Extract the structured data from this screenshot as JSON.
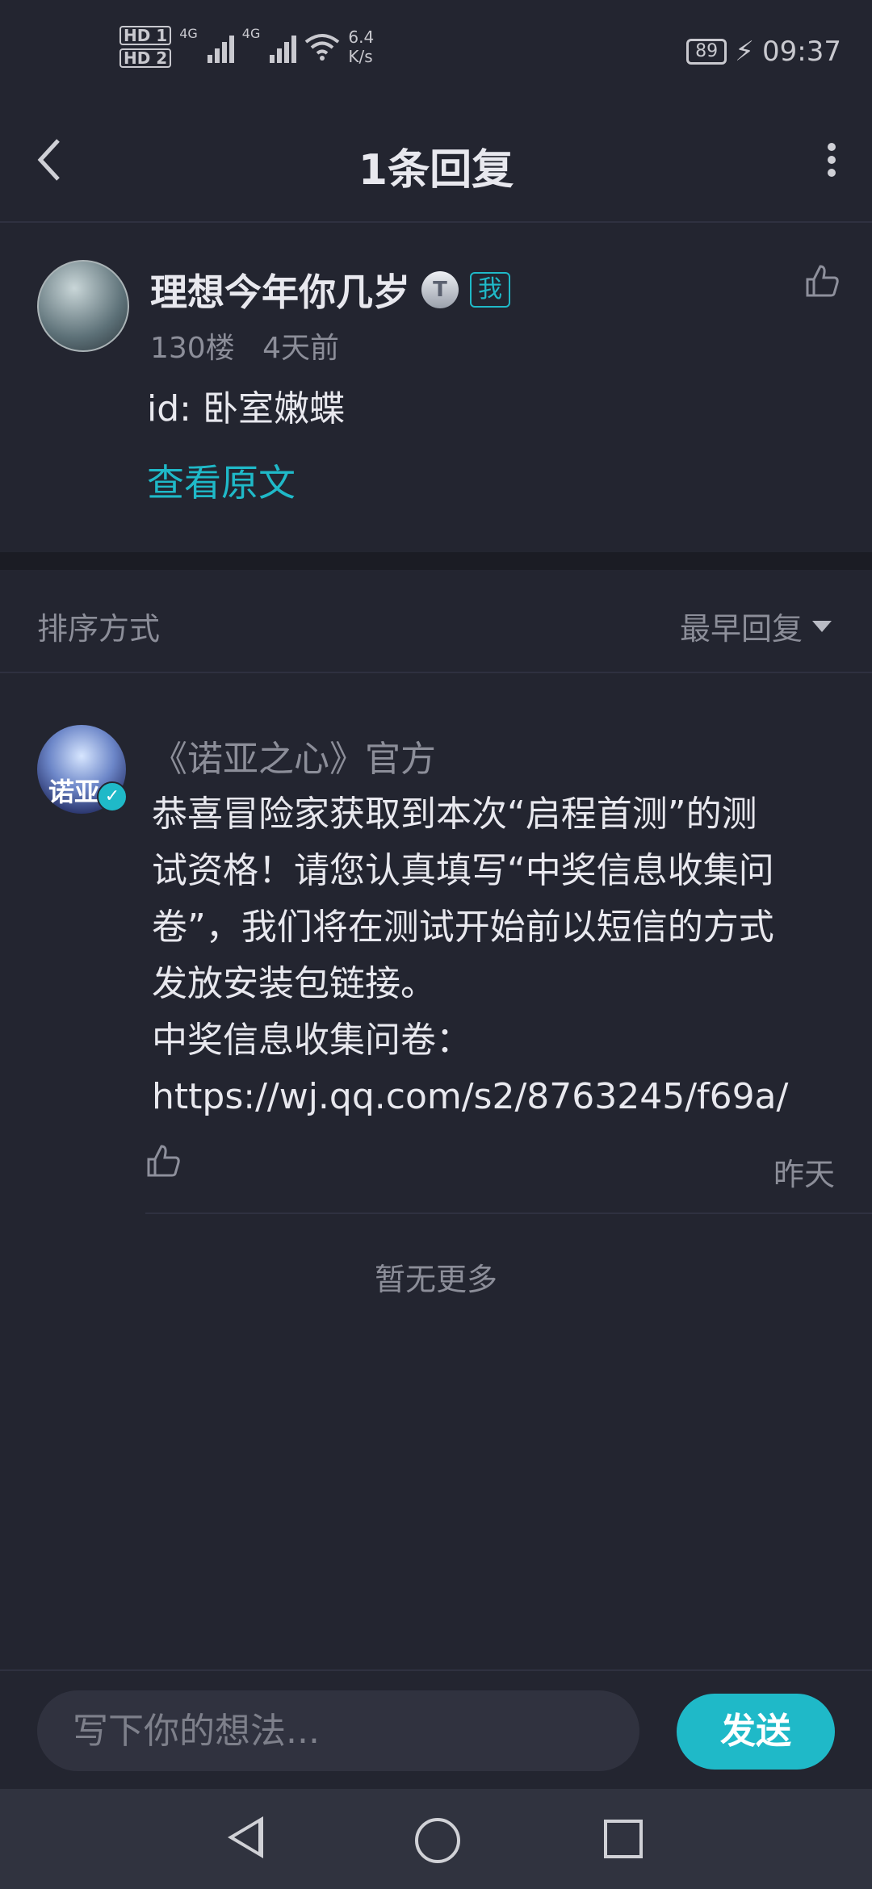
{
  "status_bar": {
    "hd1": "HD 1",
    "hd2": "HD 2",
    "net1": "4G",
    "net2": "4G",
    "speed_value": "6.4",
    "speed_unit": "K/s",
    "battery": "89",
    "time": "09:37"
  },
  "header": {
    "title": "1条回复"
  },
  "post": {
    "username": "理想今年你几岁",
    "badge_letter": "T",
    "me_tag": "我",
    "floor": "130楼",
    "time": "4天前",
    "content": "id: 卧室嫩蝶",
    "view_original": "查看原文"
  },
  "sort": {
    "label": "排序方式",
    "value": "最早回复"
  },
  "reply": {
    "author": "《诺亚之心》官方",
    "avatar_text": "诺亚",
    "content": "恭喜冒险家获取到本次“启程首测”的测\n试资格！请您认真填写“中奖信息收集问\n卷”，我们将在测试开始前以短信的方式\n发放安装包链接。\n中奖信息收集问卷：\nhttps://wj.qq.com/s2/8763245/f69a/",
    "time": "昨天"
  },
  "no_more": "暂无更多",
  "input": {
    "placeholder": "写下你的想法...",
    "send_label": "发送"
  },
  "colors": {
    "background": "#232530",
    "accent": "#1fb9c8",
    "muted_text": "#8c8e99"
  }
}
